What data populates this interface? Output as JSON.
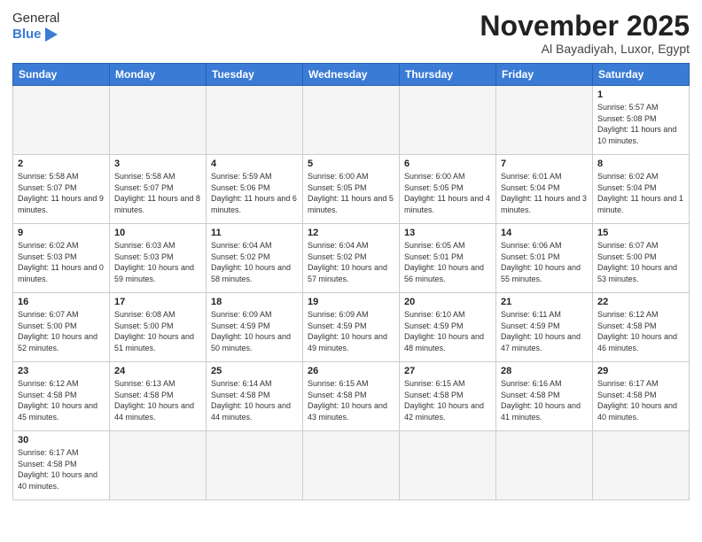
{
  "logo": {
    "general": "General",
    "blue": "Blue"
  },
  "title": "November 2025",
  "location": "Al Bayadiyah, Luxor, Egypt",
  "days_of_week": [
    "Sunday",
    "Monday",
    "Tuesday",
    "Wednesday",
    "Thursday",
    "Friday",
    "Saturday"
  ],
  "weeks": [
    [
      {
        "day": "",
        "info": ""
      },
      {
        "day": "",
        "info": ""
      },
      {
        "day": "",
        "info": ""
      },
      {
        "day": "",
        "info": ""
      },
      {
        "day": "",
        "info": ""
      },
      {
        "day": "",
        "info": ""
      },
      {
        "day": "1",
        "info": "Sunrise: 5:57 AM\nSunset: 5:08 PM\nDaylight: 11 hours and 10 minutes."
      }
    ],
    [
      {
        "day": "2",
        "info": "Sunrise: 5:58 AM\nSunset: 5:07 PM\nDaylight: 11 hours and 9 minutes."
      },
      {
        "day": "3",
        "info": "Sunrise: 5:58 AM\nSunset: 5:07 PM\nDaylight: 11 hours and 8 minutes."
      },
      {
        "day": "4",
        "info": "Sunrise: 5:59 AM\nSunset: 5:06 PM\nDaylight: 11 hours and 6 minutes."
      },
      {
        "day": "5",
        "info": "Sunrise: 6:00 AM\nSunset: 5:05 PM\nDaylight: 11 hours and 5 minutes."
      },
      {
        "day": "6",
        "info": "Sunrise: 6:00 AM\nSunset: 5:05 PM\nDaylight: 11 hours and 4 minutes."
      },
      {
        "day": "7",
        "info": "Sunrise: 6:01 AM\nSunset: 5:04 PM\nDaylight: 11 hours and 3 minutes."
      },
      {
        "day": "8",
        "info": "Sunrise: 6:02 AM\nSunset: 5:04 PM\nDaylight: 11 hours and 1 minute."
      }
    ],
    [
      {
        "day": "9",
        "info": "Sunrise: 6:02 AM\nSunset: 5:03 PM\nDaylight: 11 hours and 0 minutes."
      },
      {
        "day": "10",
        "info": "Sunrise: 6:03 AM\nSunset: 5:03 PM\nDaylight: 10 hours and 59 minutes."
      },
      {
        "day": "11",
        "info": "Sunrise: 6:04 AM\nSunset: 5:02 PM\nDaylight: 10 hours and 58 minutes."
      },
      {
        "day": "12",
        "info": "Sunrise: 6:04 AM\nSunset: 5:02 PM\nDaylight: 10 hours and 57 minutes."
      },
      {
        "day": "13",
        "info": "Sunrise: 6:05 AM\nSunset: 5:01 PM\nDaylight: 10 hours and 56 minutes."
      },
      {
        "day": "14",
        "info": "Sunrise: 6:06 AM\nSunset: 5:01 PM\nDaylight: 10 hours and 55 minutes."
      },
      {
        "day": "15",
        "info": "Sunrise: 6:07 AM\nSunset: 5:00 PM\nDaylight: 10 hours and 53 minutes."
      }
    ],
    [
      {
        "day": "16",
        "info": "Sunrise: 6:07 AM\nSunset: 5:00 PM\nDaylight: 10 hours and 52 minutes."
      },
      {
        "day": "17",
        "info": "Sunrise: 6:08 AM\nSunset: 5:00 PM\nDaylight: 10 hours and 51 minutes."
      },
      {
        "day": "18",
        "info": "Sunrise: 6:09 AM\nSunset: 4:59 PM\nDaylight: 10 hours and 50 minutes."
      },
      {
        "day": "19",
        "info": "Sunrise: 6:09 AM\nSunset: 4:59 PM\nDaylight: 10 hours and 49 minutes."
      },
      {
        "day": "20",
        "info": "Sunrise: 6:10 AM\nSunset: 4:59 PM\nDaylight: 10 hours and 48 minutes."
      },
      {
        "day": "21",
        "info": "Sunrise: 6:11 AM\nSunset: 4:59 PM\nDaylight: 10 hours and 47 minutes."
      },
      {
        "day": "22",
        "info": "Sunrise: 6:12 AM\nSunset: 4:58 PM\nDaylight: 10 hours and 46 minutes."
      }
    ],
    [
      {
        "day": "23",
        "info": "Sunrise: 6:12 AM\nSunset: 4:58 PM\nDaylight: 10 hours and 45 minutes."
      },
      {
        "day": "24",
        "info": "Sunrise: 6:13 AM\nSunset: 4:58 PM\nDaylight: 10 hours and 44 minutes."
      },
      {
        "day": "25",
        "info": "Sunrise: 6:14 AM\nSunset: 4:58 PM\nDaylight: 10 hours and 44 minutes."
      },
      {
        "day": "26",
        "info": "Sunrise: 6:15 AM\nSunset: 4:58 PM\nDaylight: 10 hours and 43 minutes."
      },
      {
        "day": "27",
        "info": "Sunrise: 6:15 AM\nSunset: 4:58 PM\nDaylight: 10 hours and 42 minutes."
      },
      {
        "day": "28",
        "info": "Sunrise: 6:16 AM\nSunset: 4:58 PM\nDaylight: 10 hours and 41 minutes."
      },
      {
        "day": "29",
        "info": "Sunrise: 6:17 AM\nSunset: 4:58 PM\nDaylight: 10 hours and 40 minutes."
      }
    ],
    [
      {
        "day": "30",
        "info": "Sunrise: 6:17 AM\nSunset: 4:58 PM\nDaylight: 10 hours and 40 minutes."
      },
      {
        "day": "",
        "info": ""
      },
      {
        "day": "",
        "info": ""
      },
      {
        "day": "",
        "info": ""
      },
      {
        "day": "",
        "info": ""
      },
      {
        "day": "",
        "info": ""
      },
      {
        "day": "",
        "info": ""
      }
    ]
  ]
}
